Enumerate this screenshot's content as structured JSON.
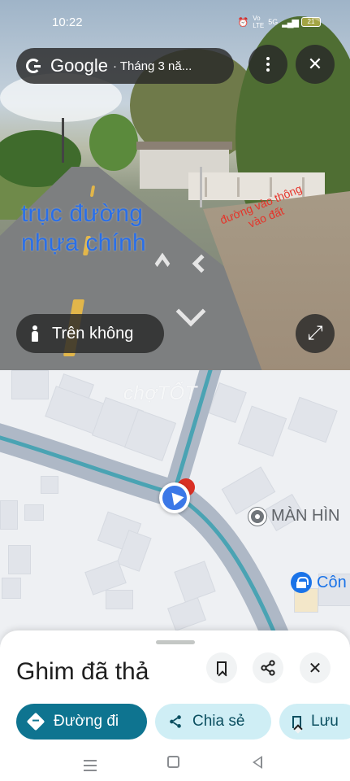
{
  "status_bar": {
    "time": "10:22",
    "icons": [
      "alarm-icon",
      "volte-icon",
      "5g-signal-icon",
      "signal-icon"
    ],
    "network_label": "5G",
    "battery": "21"
  },
  "street_view": {
    "brand": "Google",
    "date": "· Tháng 3 nă...",
    "overlay_text_line1": "trục đường",
    "overlay_text_line2": "nhựa chính",
    "overlay_note": "đường vào thông vào đất",
    "aerial_label": "Trên không"
  },
  "map": {
    "watermark": "chợTỐT",
    "poi_1": "MÀN HÌN",
    "poi_2": "Côn"
  },
  "sheet": {
    "title": "Ghim đã thả",
    "directions_label": "Đường đi",
    "share_label": "Chia sẻ",
    "save_label": "Lưu"
  },
  "colors": {
    "primary_chip": "#0e7490",
    "secondary_chip": "#cfeef5",
    "route": "#4aa3b3",
    "location": "#3b78e7",
    "drop_pin": "#d93025"
  }
}
